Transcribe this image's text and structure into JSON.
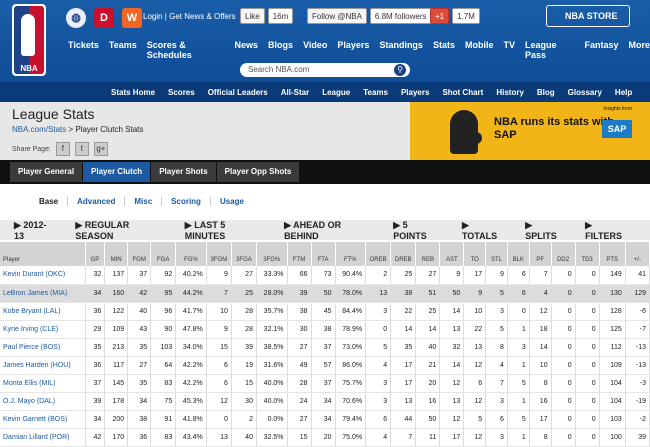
{
  "header": {
    "logo_text": "NBA",
    "toplinks": "Login | Get News & Offers",
    "facebook": {
      "label": "Like",
      "count": "16m"
    },
    "twitter": {
      "label": "Follow @NBA",
      "count": "6.8M followers"
    },
    "google": {
      "label": "+1",
      "count": "1.7M"
    },
    "store": "NBA STORE",
    "nav": [
      "Tickets",
      "Teams",
      "Scores & Schedules",
      "News",
      "Blogs",
      "Video",
      "Players",
      "Standings",
      "Stats",
      "Mobile",
      "TV",
      "League Pass",
      "Fantasy",
      "More"
    ],
    "search_placeholder": "Search NBA.com"
  },
  "stats_nav": [
    "Stats Home",
    "Scores",
    "Official Leaders",
    "All-Star",
    "League",
    "Teams",
    "Players",
    "Shot Chart",
    "History",
    "Blog",
    "Glossary",
    "Help"
  ],
  "page": {
    "title": "League Stats",
    "breadcrumb_link": "NBA.com/Stats",
    "breadcrumb_rest": " > Player Clutch Stats",
    "share": "Share Page:"
  },
  "ad": {
    "insight": "Insights from",
    "message": "NBA runs its stats with SAP",
    "logo": "SAP"
  },
  "tabs": [
    "Player General",
    "Player Clutch",
    "Player Shots",
    "Player Opp Shots"
  ],
  "subtabs": [
    "Base",
    "Advanced",
    "Misc",
    "Scoring",
    "Usage"
  ],
  "filters": [
    "▶ 2012-13",
    "▶ REGULAR SEASON",
    "▶ LAST 5 MINUTES",
    "▶ AHEAD OR BEHIND",
    "▶ 5 POINTS",
    "▶ TOTALS",
    "▶ SPLITS",
    "▶ FILTERS"
  ],
  "table": {
    "headers": [
      "Player",
      "GP",
      "MIN",
      "FGM",
      "FGA",
      "FG%",
      "3FGM",
      "3FGA",
      "3FG%",
      "FTM",
      "FTA",
      "FT%",
      "OREB",
      "DREB",
      "REB",
      "AST",
      "TO",
      "STL",
      "BLK",
      "PF",
      "DD2",
      "TD3",
      "PTS",
      "+/-"
    ],
    "rows": [
      [
        "Kevin Durant (OKC)",
        "32",
        "137",
        "37",
        "92",
        "40.2%",
        "9",
        "27",
        "33.3%",
        "66",
        "73",
        "90.4%",
        "2",
        "25",
        "27",
        "9",
        "17",
        "9",
        "6",
        "7",
        "0",
        "0",
        "149",
        "41"
      ],
      [
        "LeBron James (MIA)",
        "34",
        "160",
        "42",
        "95",
        "44.2%",
        "7",
        "25",
        "28.0%",
        "39",
        "50",
        "78.0%",
        "13",
        "38",
        "51",
        "50",
        "9",
        "5",
        "6",
        "4",
        "0",
        "0",
        "130",
        "129"
      ],
      [
        "Kobe Bryant (LAL)",
        "36",
        "122",
        "40",
        "96",
        "41.7%",
        "10",
        "28",
        "35.7%",
        "38",
        "45",
        "84.4%",
        "3",
        "22",
        "25",
        "14",
        "10",
        "3",
        "0",
        "12",
        "0",
        "0",
        "128",
        "-6"
      ],
      [
        "Kyrie Irving (CLE)",
        "29",
        "109",
        "43",
        "90",
        "47.8%",
        "9",
        "28",
        "32.1%",
        "30",
        "38",
        "78.9%",
        "0",
        "14",
        "14",
        "13",
        "22",
        "5",
        "1",
        "18",
        "0",
        "0",
        "125",
        "-7"
      ],
      [
        "Paul Pierce (BOS)",
        "35",
        "213",
        "35",
        "103",
        "34.0%",
        "15",
        "39",
        "38.5%",
        "27",
        "37",
        "73.0%",
        "5",
        "35",
        "40",
        "32",
        "13",
        "8",
        "3",
        "14",
        "0",
        "0",
        "112",
        "-13"
      ],
      [
        "James Harden (HOU)",
        "36",
        "117",
        "27",
        "64",
        "42.2%",
        "6",
        "19",
        "31.6%",
        "49",
        "57",
        "86.0%",
        "4",
        "17",
        "21",
        "14",
        "12",
        "4",
        "1",
        "10",
        "0",
        "0",
        "109",
        "-13"
      ],
      [
        "Monta Ellis (MIL)",
        "37",
        "145",
        "35",
        "83",
        "42.2%",
        "6",
        "15",
        "40.0%",
        "28",
        "37",
        "75.7%",
        "3",
        "17",
        "20",
        "12",
        "6",
        "7",
        "5",
        "8",
        "0",
        "0",
        "104",
        "-3"
      ],
      [
        "O.J. Mayo (DAL)",
        "39",
        "178",
        "34",
        "75",
        "45.3%",
        "12",
        "30",
        "40.0%",
        "24",
        "34",
        "70.6%",
        "3",
        "13",
        "16",
        "13",
        "12",
        "3",
        "1",
        "16",
        "0",
        "0",
        "104",
        "-19"
      ],
      [
        "Kevin Garnett (BOS)",
        "34",
        "200",
        "38",
        "91",
        "41.8%",
        "0",
        "2",
        "0.0%",
        "27",
        "34",
        "79.4%",
        "6",
        "44",
        "50",
        "12",
        "5",
        "6",
        "5",
        "17",
        "0",
        "0",
        "103",
        "-2"
      ],
      [
        "Damian Lillard (POR)",
        "42",
        "170",
        "36",
        "83",
        "43.4%",
        "13",
        "40",
        "32.5%",
        "15",
        "20",
        "75.0%",
        "4",
        "7",
        "11",
        "17",
        "12",
        "3",
        "1",
        "8",
        "0",
        "0",
        "100",
        "39"
      ]
    ]
  }
}
